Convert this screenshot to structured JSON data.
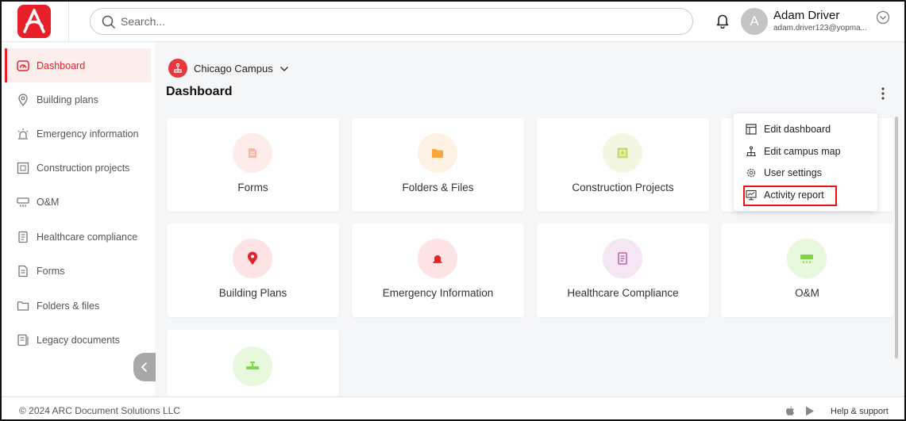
{
  "header": {
    "search_placeholder": "Search...",
    "user": {
      "initial": "A",
      "name": "Adam Driver",
      "email": "adam.driver123@yopma..."
    }
  },
  "sidebar": {
    "items": [
      {
        "label": "Dashboard",
        "icon": "speedometer-icon",
        "active": true
      },
      {
        "label": "Building plans",
        "icon": "location-pin-icon"
      },
      {
        "label": "Emergency information",
        "icon": "siren-icon"
      },
      {
        "label": "Construction projects",
        "icon": "blueprint-icon"
      },
      {
        "label": "O&M",
        "icon": "air-conditioner-icon"
      },
      {
        "label": "Healthcare compliance",
        "icon": "document-icon"
      },
      {
        "label": "Forms",
        "icon": "form-icon"
      },
      {
        "label": "Folders & files",
        "icon": "folder-icon"
      },
      {
        "label": "Legacy documents",
        "icon": "legacy-document-icon"
      }
    ]
  },
  "main": {
    "campus": "Chicago Campus",
    "title": "Dashboard",
    "cards": [
      {
        "label": "Forms",
        "icon": "form-icon"
      },
      {
        "label": "Folders & Files",
        "icon": "folder-icon"
      },
      {
        "label": "Construction Projects",
        "icon": "blueprint-icon"
      },
      {
        "label": "Building Plans",
        "icon": "location-pin-icon"
      },
      {
        "label": "Emergency Information",
        "icon": "siren-icon"
      },
      {
        "label": "Healthcare Compliance",
        "icon": "document-icon"
      },
      {
        "label": "O&M",
        "icon": "air-conditioner-icon"
      },
      {
        "label": "",
        "icon": "valve-icon"
      }
    ]
  },
  "menu": {
    "items": [
      {
        "label": "Edit dashboard",
        "icon": "dashboard-edit-icon"
      },
      {
        "label": "Edit campus map",
        "icon": "campus-map-icon"
      },
      {
        "label": "User settings",
        "icon": "gear-icon"
      },
      {
        "label": "Activity report",
        "icon": "activity-report-icon"
      }
    ]
  },
  "footer": {
    "copyright": "© 2024 ARC Document Solutions LLC",
    "help": "Help & support"
  },
  "colors": {
    "brand": "#e8202a",
    "active_bg": "#fdeeee",
    "page_bg": "#f5f6f8"
  }
}
